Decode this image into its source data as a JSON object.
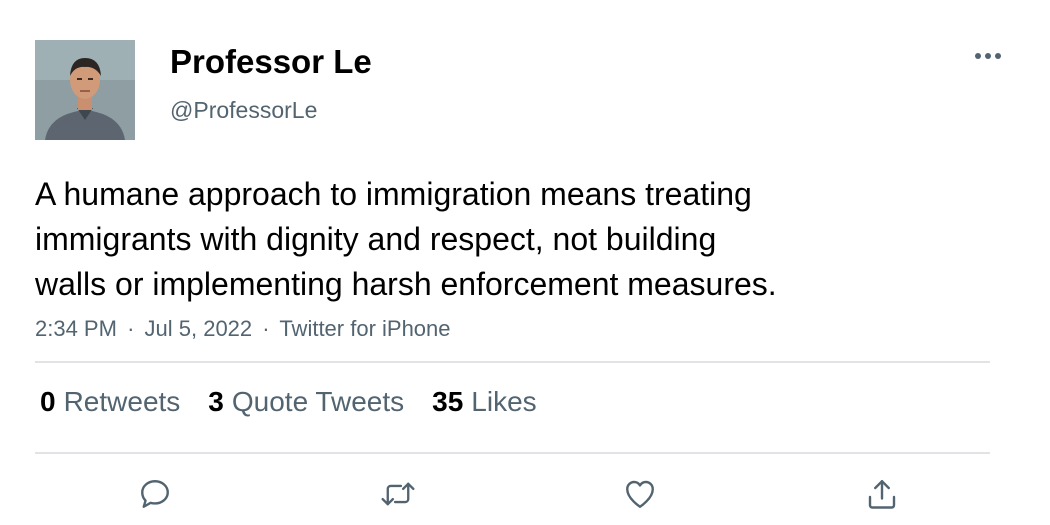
{
  "author": {
    "display_name": "Professor Le",
    "handle": "@ProfessorLe",
    "avatar_icon": "avatar-photo"
  },
  "tweet": {
    "lines": [
      "A humane approach to immigration means treating",
      "immigrants with dignity and respect, not building",
      "walls or implementing harsh enforcement measures."
    ],
    "time": "2:34 PM",
    "date": "Jul 5, 2022",
    "source": "Twitter for iPhone",
    "separator": "·"
  },
  "stats": {
    "retweets": {
      "count": "0",
      "label": "Retweets"
    },
    "quote_tweets": {
      "count": "3",
      "label": "Quote Tweets"
    },
    "likes": {
      "count": "35",
      "label": "Likes"
    }
  },
  "actions": [
    "reply-icon",
    "retweet-icon",
    "like-icon",
    "share-icon"
  ],
  "colors": {
    "text": "#000000",
    "secondary": "#536471",
    "divider": "#e1e3e6"
  }
}
